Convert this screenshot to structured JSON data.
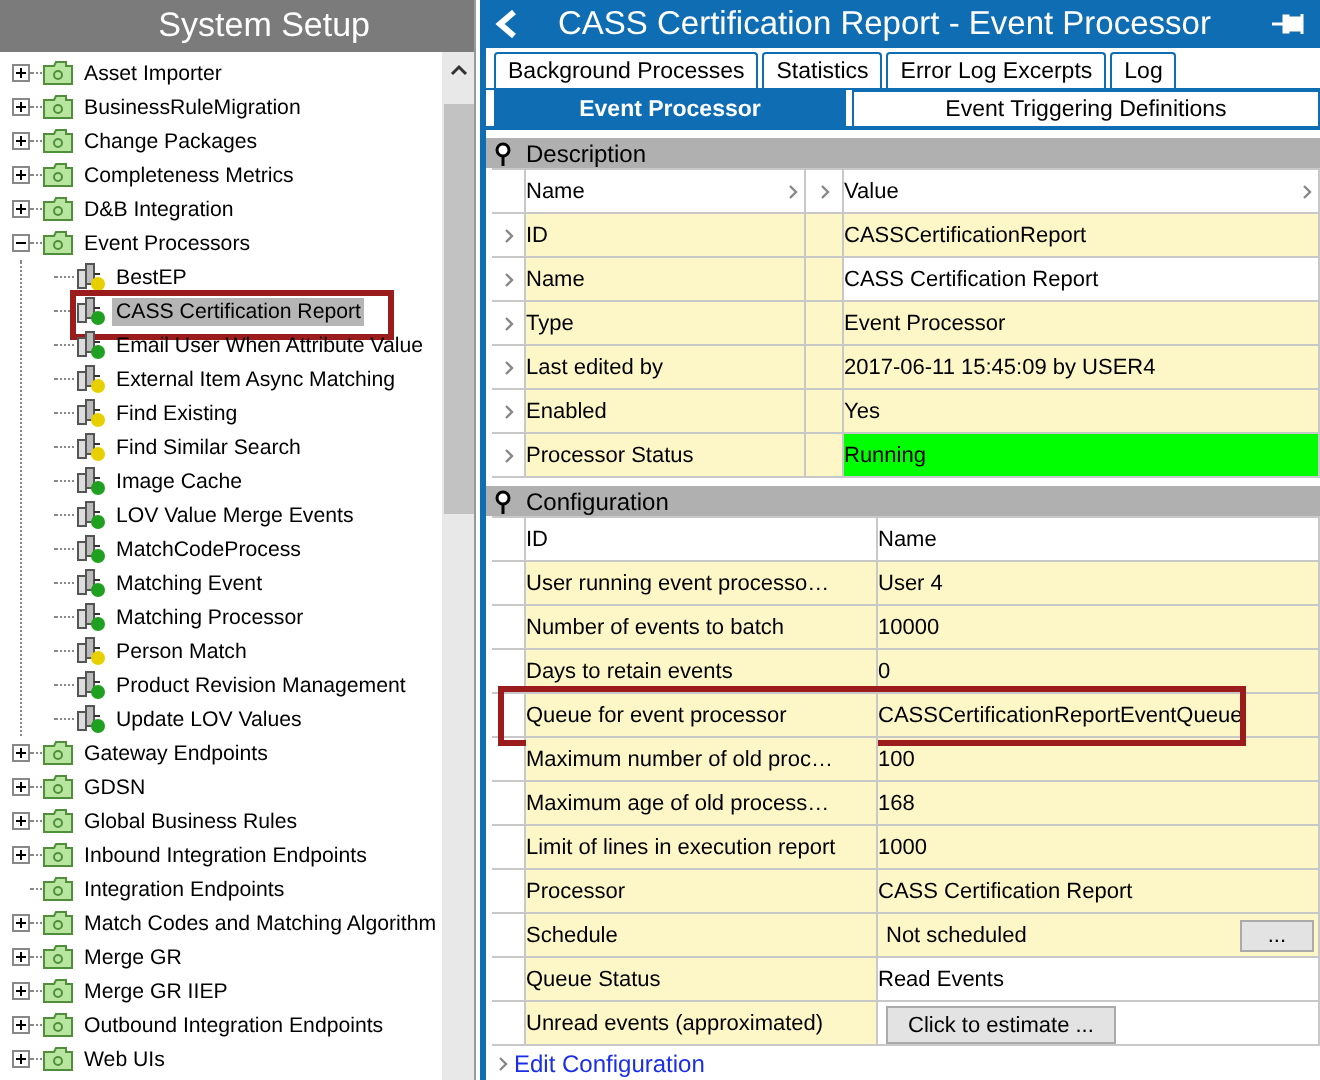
{
  "left_panel": {
    "title": "System Setup",
    "tree": [
      {
        "label": "Asset Importer",
        "kind": "folder",
        "expanded": false
      },
      {
        "label": "BusinessRuleMigration",
        "kind": "folder",
        "expanded": false
      },
      {
        "label": "Change Packages",
        "kind": "folder",
        "expanded": false
      },
      {
        "label": "Completeness Metrics",
        "kind": "folder",
        "expanded": false
      },
      {
        "label": "D&B Integration",
        "kind": "folder",
        "expanded": false
      },
      {
        "label": "Event Processors",
        "kind": "folder",
        "expanded": true,
        "children": [
          {
            "label": "BestEP",
            "kind": "processor",
            "color": "#e8d000",
            "selected": false,
            "highlighted": false
          },
          {
            "label": "CASS Certification Report",
            "kind": "processor",
            "color": "#20a020",
            "selected": true,
            "highlighted": true
          },
          {
            "label": "Email User When Attribute Value",
            "kind": "processor",
            "color": "#20a020",
            "selected": false,
            "highlighted": false
          },
          {
            "label": "External Item Async Matching",
            "kind": "processor",
            "color": "#e8d000",
            "selected": false,
            "highlighted": false
          },
          {
            "label": "Find Existing",
            "kind": "processor",
            "color": "#e8d000",
            "selected": false,
            "highlighted": false
          },
          {
            "label": "Find Similar Search",
            "kind": "processor",
            "color": "#e8d000",
            "selected": false,
            "highlighted": false
          },
          {
            "label": "Image Cache",
            "kind": "processor",
            "color": "#20a020",
            "selected": false,
            "highlighted": false
          },
          {
            "label": "LOV Value Merge Events",
            "kind": "processor",
            "color": "#20a020",
            "selected": false,
            "highlighted": false
          },
          {
            "label": "MatchCodeProcess",
            "kind": "processor",
            "color": "#20a020",
            "selected": false,
            "highlighted": false
          },
          {
            "label": "Matching Event",
            "kind": "processor",
            "color": "#20a020",
            "selected": false,
            "highlighted": false
          },
          {
            "label": "Matching Processor",
            "kind": "processor",
            "color": "#20a020",
            "selected": false,
            "highlighted": false
          },
          {
            "label": "Person Match",
            "kind": "processor",
            "color": "#e8d000",
            "selected": false,
            "highlighted": false
          },
          {
            "label": "Product Revision Management",
            "kind": "processor",
            "color": "#20a020",
            "selected": false,
            "highlighted": false
          },
          {
            "label": "Update LOV Values",
            "kind": "processor",
            "color": "#20a020",
            "selected": false,
            "highlighted": false
          }
        ]
      },
      {
        "label": "Gateway Endpoints",
        "kind": "folder",
        "expanded": false
      },
      {
        "label": "GDSN",
        "kind": "folder",
        "expanded": false
      },
      {
        "label": "Global Business Rules",
        "kind": "folder",
        "expanded": false
      },
      {
        "label": "Inbound Integration Endpoints",
        "kind": "folder",
        "expanded": false
      },
      {
        "label": "Integration Endpoints",
        "kind": "empty-folder"
      },
      {
        "label": "Match Codes and Matching Algorithm",
        "kind": "folder",
        "expanded": false
      },
      {
        "label": "Merge GR",
        "kind": "folder",
        "expanded": false
      },
      {
        "label": "Merge GR IIEP",
        "kind": "folder",
        "expanded": false
      },
      {
        "label": "Outbound Integration Endpoints",
        "kind": "folder",
        "expanded": false
      },
      {
        "label": "Web UIs",
        "kind": "folder",
        "expanded": false
      }
    ]
  },
  "right_panel": {
    "title": "CASS Certification Report - Event Processor",
    "tabs": [
      {
        "label": "Background Processes",
        "selected": false
      },
      {
        "label": "Statistics",
        "selected": false
      },
      {
        "label": "Error Log Excerpts",
        "selected": false
      },
      {
        "label": "Log",
        "selected": false
      }
    ],
    "subtabs": [
      {
        "label": "Event Processor",
        "selected": true
      },
      {
        "label": "Event Triggering Definitions",
        "selected": false
      }
    ],
    "description": {
      "title": "Description",
      "columns": [
        "Name",
        "Value"
      ],
      "rows": [
        {
          "name": "ID",
          "value": "CASSCertificationReport",
          "editable": false
        },
        {
          "name": "Name",
          "value": "CASS Certification Report",
          "editable": true
        },
        {
          "name": "Type",
          "value": "Event Processor",
          "editable": false
        },
        {
          "name": "Last edited by",
          "value": "2017-06-11 15:45:09 by USER4",
          "editable": false
        },
        {
          "name": "Enabled",
          "value": "Yes",
          "editable": false
        },
        {
          "name": "Processor Status",
          "value": "Running",
          "color": "#00ff00"
        }
      ]
    },
    "configuration": {
      "title": "Configuration",
      "columns": [
        "ID",
        "Name"
      ],
      "rows": [
        {
          "kind": "text",
          "name": "User running event processo…",
          "value": "User 4",
          "editable": false,
          "highlighted": false
        },
        {
          "kind": "text",
          "name": "Number of events to batch",
          "value": "10000",
          "editable": false,
          "highlighted": false
        },
        {
          "kind": "text",
          "name": "Days to retain events",
          "value": "0",
          "editable": false,
          "highlighted": false
        },
        {
          "kind": "text",
          "name": "Queue for event processor",
          "value": "CASSCertificationReportEventQueue",
          "editable": false,
          "highlighted": true
        },
        {
          "kind": "text",
          "name": "Maximum number of old proc…",
          "value": "100",
          "editable": false,
          "highlighted": false
        },
        {
          "kind": "text",
          "name": "Maximum age of old process…",
          "value": "168",
          "editable": false,
          "highlighted": false
        },
        {
          "kind": "text",
          "name": "Limit of lines in execution report",
          "value": "1000",
          "editable": false,
          "highlighted": false
        },
        {
          "kind": "text",
          "name": "Processor",
          "value": "CASS Certification Report",
          "editable": false,
          "highlighted": false
        },
        {
          "kind": "picker",
          "name": "Schedule",
          "value": "Not scheduled",
          "button": "...",
          "highlighted": false
        },
        {
          "kind": "text",
          "name": "Queue Status",
          "value": "Read Events",
          "editable": true,
          "highlighted": false
        },
        {
          "kind": "action",
          "name": "Unread events (approximated)",
          "button": "Click to estimate ...",
          "highlighted": false
        }
      ],
      "link": "Edit Configuration"
    }
  }
}
